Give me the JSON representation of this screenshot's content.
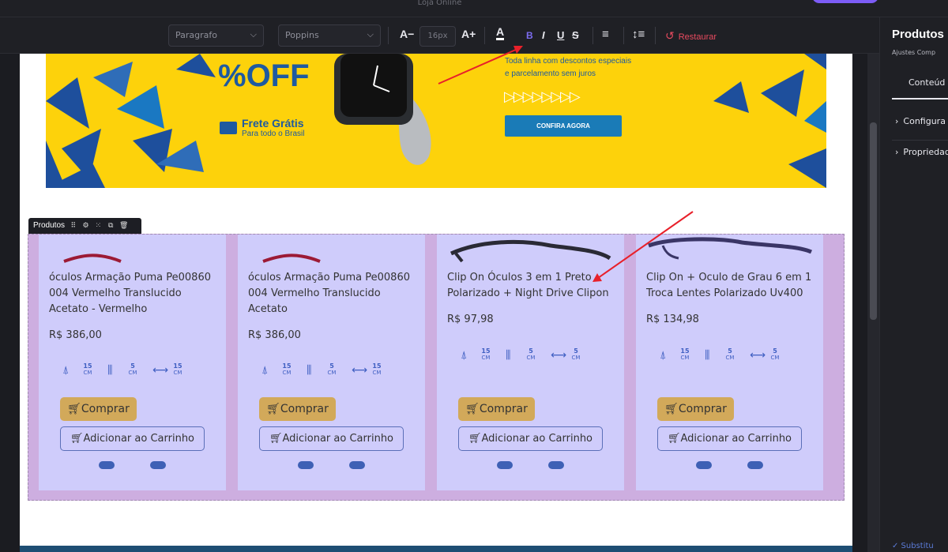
{
  "window": {
    "title": "Loja Online"
  },
  "toolbar": {
    "paragraph_select": "Paragrafo",
    "font_select": "Poppins",
    "decrease_label": "A−",
    "font_size_placeholder": "16px",
    "increase_label": "A+",
    "text_color_label": "A",
    "bold_label": "B",
    "italic_label": "I",
    "underline_label": "U",
    "strike_label": "S",
    "restore_label": "Restaurar"
  },
  "banner": {
    "off_text": "%OFF",
    "frete_title": "Frete Grátis",
    "frete_sub": "Para todo o Brasil",
    "promo_line1": "Toda linha com descontos especiais",
    "promo_line2": "e parcelamento sem juros",
    "arrows": "▷▷▷▷▷▷▷▷",
    "cta": "CONFIRA AGORA"
  },
  "component": {
    "label": "Produtos",
    "icons": [
      "⠿",
      "⚙",
      "⁙",
      "⧉",
      "🗑"
    ]
  },
  "products": [
    {
      "name": "óculos Armação Puma Pe00860 004 Vermelho Translucido Acetato - Vermelho",
      "price": "R$ 386,00",
      "dims": [
        "15",
        "5",
        "15"
      ],
      "unit": "CM",
      "glasses": "red-temple"
    },
    {
      "name": "óculos Armação Puma Pe00860 004 Vermelho Translucido Acetato",
      "price": "R$ 386,00",
      "dims": [
        "15",
        "5",
        "15"
      ],
      "unit": "CM",
      "glasses": "red-temple"
    },
    {
      "name": "Clip On Óculos 3 em 1 Preto Polarizado + Night Drive Clipon",
      "price": "R$ 97,98",
      "dims": [
        "15",
        "5",
        "5"
      ],
      "unit": "CM",
      "glasses": "dark-frame"
    },
    {
      "name": "Clip On + Oculo de Grau 6 em 1 Troca Lentes Polarizado Uv400",
      "price": "R$ 134,98",
      "dims": [
        "15",
        "5",
        "5"
      ],
      "unit": "CM",
      "glasses": "purple-frame"
    }
  ],
  "buttons": {
    "buy": "Comprar",
    "add_to_cart": "Adicionar ao Carrinho"
  },
  "right_panel": {
    "title": "Produtos",
    "subtitle": "Ajustes Comp",
    "tab": "Conteúd",
    "section1": "Configura",
    "section2": "Propriedad",
    "substitute": "✓ Substitu"
  },
  "colors": {
    "accent": "#7c5cf6",
    "restore": "#e84a5f",
    "card": "#cfccfb",
    "buy": "#d2a95a",
    "annotation_arrow": "#e8202a"
  }
}
